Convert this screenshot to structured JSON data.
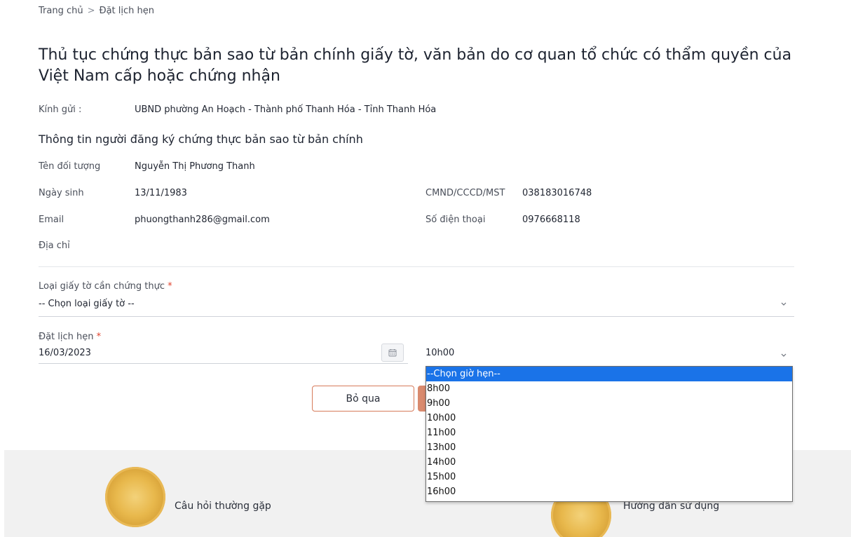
{
  "breadcrumb": {
    "home": "Trang chủ",
    "separator": ">",
    "current": "Đặt lịch hẹn"
  },
  "title": "Thủ tục chứng thực bản sao từ bản chính giấy tờ, văn bản do cơ quan tổ chức có thẩm quyền của Việt Nam cấp hoặc chứng nhận",
  "recipient": {
    "label": "Kính gửi :",
    "value": "UBND phường An Hoạch - Thành phố Thanh Hóa - Tỉnh Thanh Hóa"
  },
  "applicant": {
    "section_title": "Thông tin người đăng ký chứng thực bản sao từ bản chính",
    "name_label": "Tên đối tượng",
    "name": "Nguyễn Thị Phương Thanh",
    "dob_label": "Ngày sinh",
    "dob": "13/11/1983",
    "id_label": "CMND/CCCD/MST",
    "id": "038183016748",
    "email_label": "Email",
    "email": "phuongthanh286@gmail.com",
    "phone_label": "Số điện thoại",
    "phone": "0976668118",
    "address_label": "Địa chỉ",
    "address": ""
  },
  "form": {
    "doc_type_label": "Loại giấy tờ cần chứng thực",
    "required_mark": "*",
    "doc_type_value": "-- Chọn loại giấy tờ --",
    "appointment_label": "Đặt lịch hẹn",
    "date_value": "16/03/2023",
    "time_value": "10h00",
    "time_options": [
      "--Chọn giờ hẹn--",
      "8h00",
      "9h00",
      "10h00",
      "11h00",
      "13h00",
      "14h00",
      "15h00",
      "16h00"
    ],
    "highlighted_option": "--Chọn giờ hẹn--"
  },
  "buttons": {
    "skip": "Bỏ qua"
  },
  "footer": {
    "faq": "Câu hỏi thường gặp",
    "guide": "Hướng dẫn sử dụng"
  },
  "icons": {
    "calendar": "calendar-icon",
    "chevron": "chevron-down-icon",
    "emblem": "national-emblem"
  },
  "colors": {
    "accent": "#d67a5a",
    "required": "#e0432e",
    "highlight": "#1a73e8",
    "footer_bg": "#f1f1f1"
  }
}
